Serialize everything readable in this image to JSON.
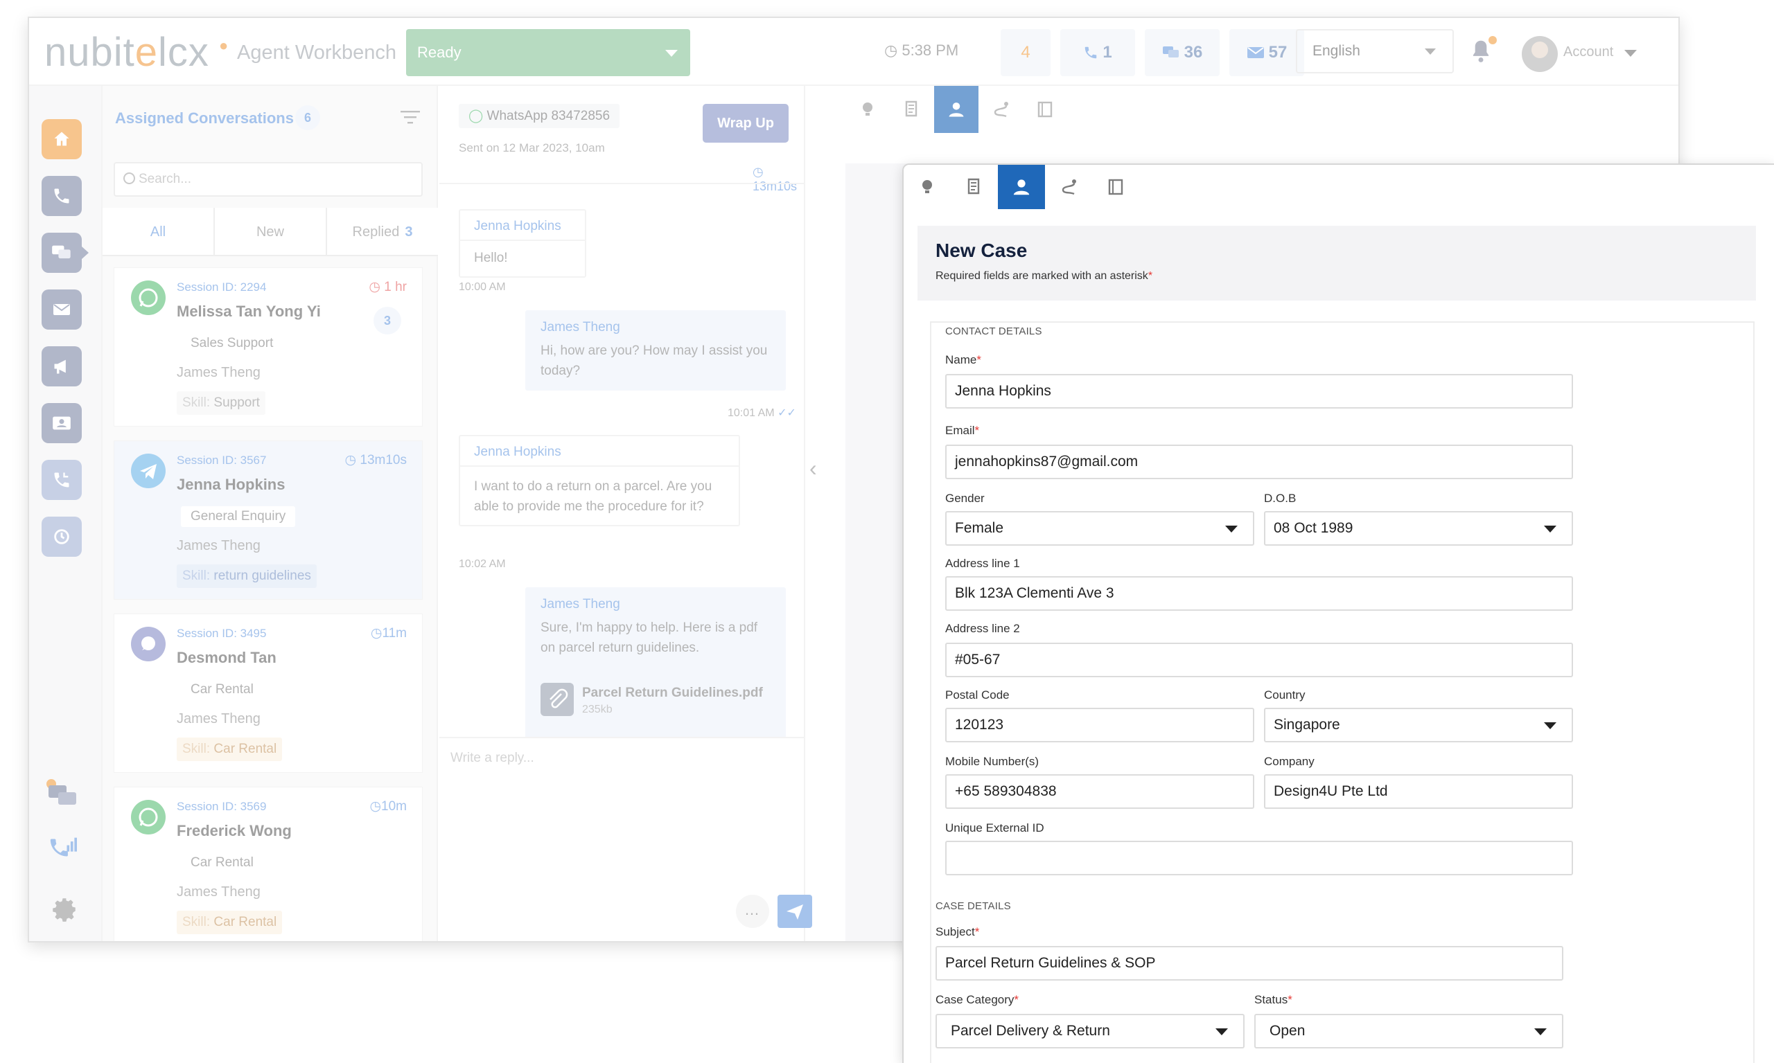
{
  "colors": {
    "accent": "#6f9fe0",
    "status_ready": "#8cc59c",
    "wrap_up": "#8a96c8",
    "active_tab": "#1f68b9",
    "required": "#e53935",
    "brand_orange": "#f1a14b"
  },
  "header": {
    "logo_text_a": "nubit",
    "logo_text_o": "e",
    "logo_text_b": "lcx",
    "app_name": "Agent Workbench",
    "status": "Ready",
    "clock": "5:38 PM",
    "counter_orange": "4",
    "counter_calls": "1",
    "counter_chats": "36",
    "counter_emails": "57",
    "language": "English",
    "account_label": "Account"
  },
  "sidebar": {
    "items": [
      {
        "name": "home-icon",
        "color": "#f3a248"
      },
      {
        "name": "phone-icon",
        "color": "#828ba8"
      },
      {
        "name": "chat-icon",
        "color": "#828ba8"
      },
      {
        "name": "email-icon",
        "color": "#828ba8"
      },
      {
        "name": "megaphone-icon",
        "color": "#828ba8"
      },
      {
        "name": "contact-card-icon",
        "color": "#828ba8"
      },
      {
        "name": "callback-icon",
        "color": "#a5b3d6"
      },
      {
        "name": "history-icon",
        "color": "#a5b3d6"
      }
    ],
    "bottom_icons": [
      "chat-bubbles-icon",
      "call-stats-icon",
      "settings-icon"
    ]
  },
  "conversations": {
    "title": "Assigned Conversations",
    "count": "6",
    "search_placeholder": "Search...",
    "tabs": {
      "all": "All",
      "new": "New",
      "replied": "Replied",
      "replied_count": "3"
    },
    "items": [
      {
        "session": "Session ID: 2294",
        "time": "1 hr",
        "name": "Melissa Tan Yong Yi",
        "queue": "Sales Support",
        "agent": "James Theng",
        "skill_key": "Skill:",
        "skill": "Support",
        "unread": "3",
        "channel": "whatsapp"
      },
      {
        "session": "Session ID: 3567",
        "time": "13m10s",
        "name": "Jenna Hopkins",
        "queue": "General Enquiry",
        "agent": "James Theng",
        "skill_key": "Skill:",
        "skill": "return guidelines",
        "unread": "",
        "channel": "telegram"
      },
      {
        "session": "Session ID: 3495",
        "time": "11m",
        "name": "Desmond Tan",
        "queue": "Car Rental",
        "agent": "James Theng",
        "skill_key": "Skill:",
        "skill": "Car Rental",
        "unread": "",
        "channel": "webchat"
      },
      {
        "session": "Session ID: 3569",
        "time": "10m",
        "name": "Frederick Wong",
        "queue": "Car Rental",
        "agent": "James Theng",
        "skill_key": "Skill:",
        "skill": "Car Rental",
        "unread": "",
        "channel": "whatsapp"
      }
    ]
  },
  "chat": {
    "channel": "WhatsApp 83472856",
    "sent_on": "Sent on 12 Mar 2023, 10am",
    "wrap_up": "Wrap Up",
    "timer": "13m10s",
    "messages": [
      {
        "who": "Jenna Hopkins",
        "text": "Hello!",
        "time": "10:00 AM"
      },
      {
        "who": "James Theng",
        "text": "Hi, how are you? How may I assist you today?",
        "time": "10:01 AM"
      },
      {
        "who": "Jenna Hopkins",
        "text": "I want to do a return on a parcel. Are you able to provide me the procedure for it?",
        "time": "10:02 AM"
      },
      {
        "who": "James Theng",
        "text": "Sure, I'm happy to help. Here is a pdf on parcel return guidelines.",
        "time": ""
      }
    ],
    "attachment": {
      "name": "Parcel Return Guidelines.pdf",
      "size": "235kb"
    },
    "reply_placeholder": "Write a reply..."
  },
  "new_case": {
    "title": "New Case",
    "subtitle": "Required fields are marked with an asterisk",
    "asterisk": "*",
    "contact_section": "CONTACT DETAILS",
    "case_section": "CASE DETAILS",
    "fields": {
      "name_label": "Name",
      "name": "Jenna Hopkins",
      "email_label": "Email",
      "email": "jennahopkins87@gmail.com",
      "gender_label": "Gender",
      "gender": "Female",
      "dob_label": "D.O.B",
      "dob": "08 Oct 1989",
      "addr1_label": "Address line 1",
      "addr1": "Blk 123A Clementi Ave 3",
      "addr2_label": "Address line 2",
      "addr2": "#05-67",
      "postal_label": "Postal Code",
      "postal": "120123",
      "country_label": "Country",
      "country": "Singapore",
      "mobile_label": "Mobile Number(s)",
      "mobile": "+65 589304838",
      "company_label": "Company",
      "company": "Design4U Pte Ltd",
      "extid_label": "Unique External ID",
      "extid": "",
      "subject_label": "Subject",
      "subject": "Parcel Return Guidelines & SOP",
      "category_label": "Case Category",
      "category": "Parcel Delivery & Return",
      "status_label": "Status",
      "status": "Open"
    }
  }
}
